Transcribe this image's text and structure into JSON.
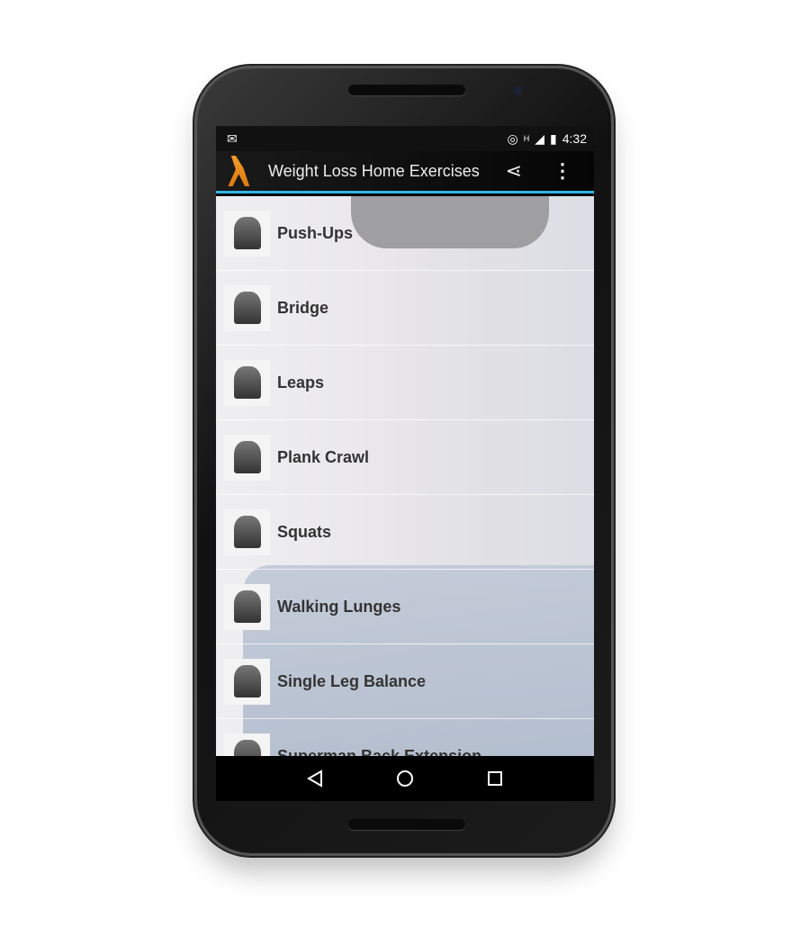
{
  "status_bar": {
    "notification_icon": "gmail-icon",
    "time": "4:32",
    "network": "H"
  },
  "action_bar": {
    "title": "Weight Loss Home Exercises",
    "share_icon": "share-icon",
    "menu_icon": "overflow-menu-icon",
    "accent": "#33b5e5"
  },
  "exercises": [
    {
      "label": "Push-Ups"
    },
    {
      "label": "Bridge"
    },
    {
      "label": "Leaps"
    },
    {
      "label": "Plank Crawl"
    },
    {
      "label": "Squats"
    },
    {
      "label": "Walking Lunges"
    },
    {
      "label": "Single Leg Balance"
    },
    {
      "label": "Superman Back Extension"
    }
  ],
  "nav_bar": {
    "back": "back-icon",
    "home": "home-icon",
    "recents": "recents-icon"
  }
}
